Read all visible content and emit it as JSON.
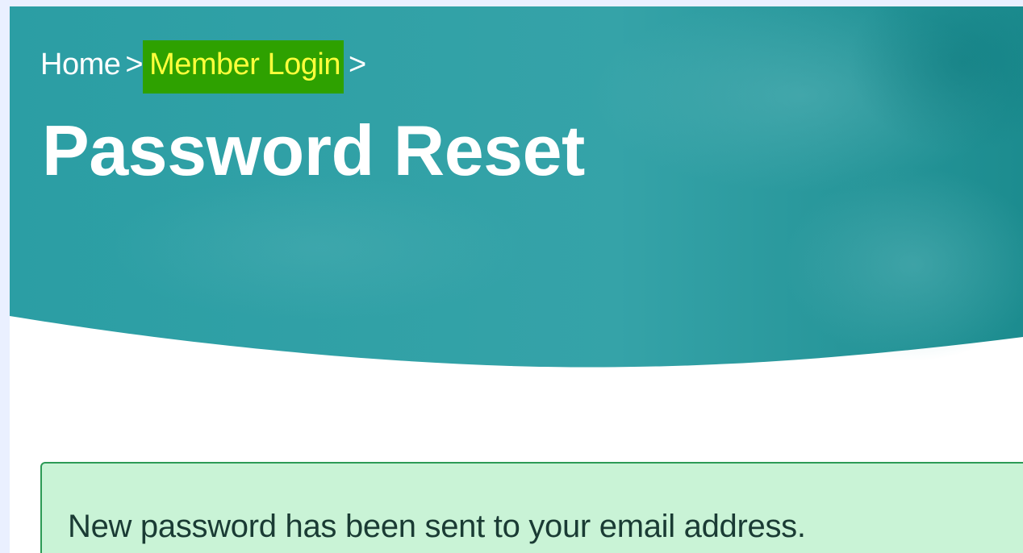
{
  "breadcrumb": {
    "home_label": "Home",
    "separator": ">",
    "current_label": "Member Login",
    "trailing_separator": ">"
  },
  "page": {
    "title": "Password Reset"
  },
  "alert": {
    "message": "New password has been sent to your email address."
  },
  "colors": {
    "hero_teal": "#2f9fa4",
    "breadcrumb_highlight_bg": "#2ea100",
    "breadcrumb_highlight_text": "#ffff3b",
    "alert_bg": "#c9f3d6",
    "alert_border": "#2c9a56"
  }
}
